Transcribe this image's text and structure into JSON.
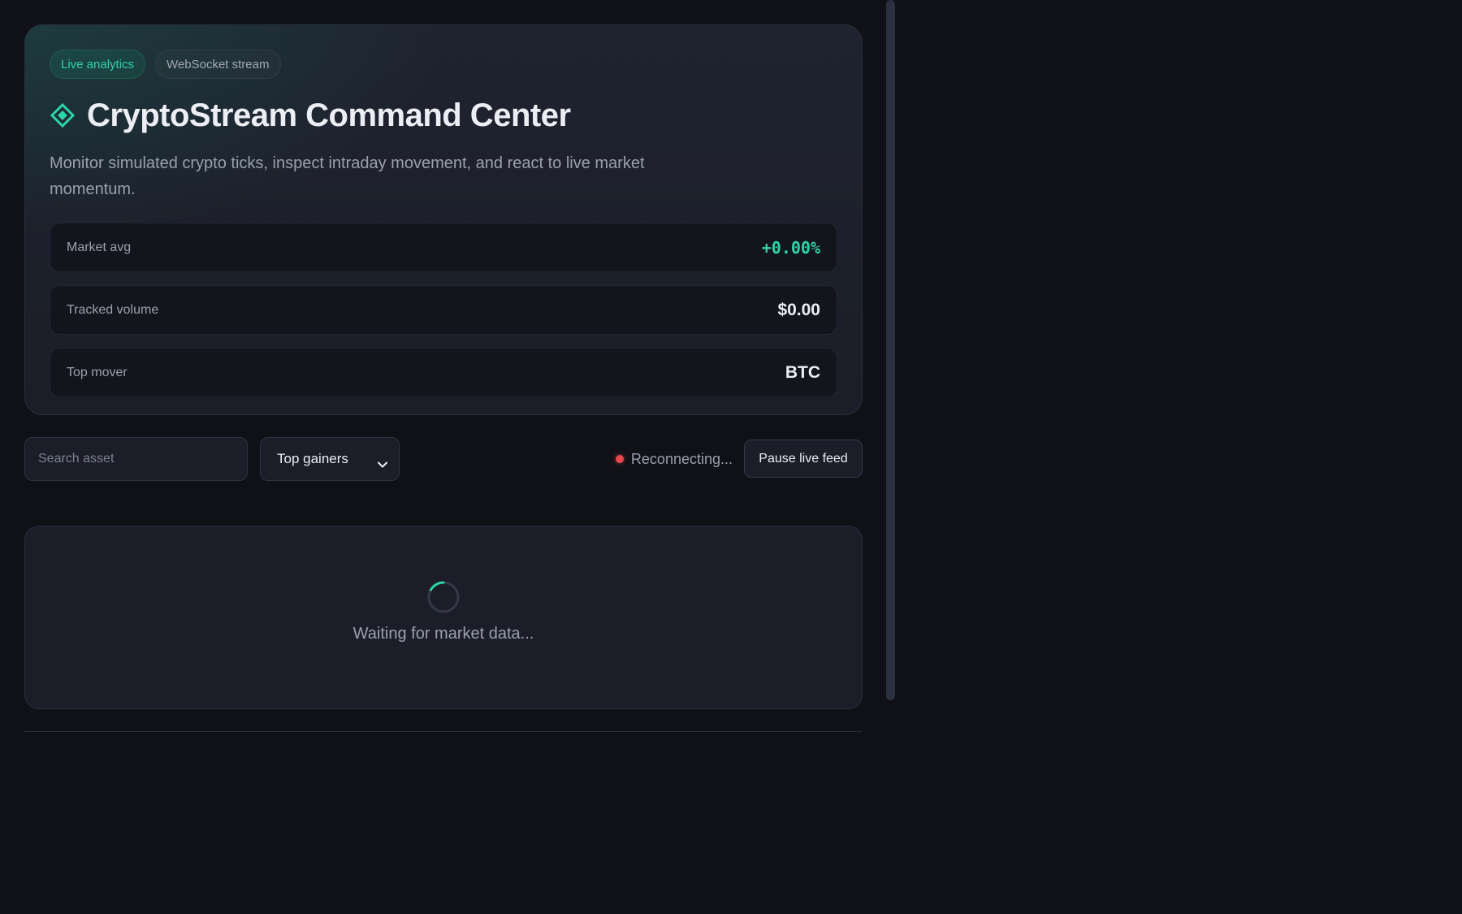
{
  "hero": {
    "pills": [
      "Live analytics",
      "WebSocket stream"
    ],
    "icon": "diamond-icon",
    "title": "CryptoStream Command Center",
    "subtitle": "Monitor simulated crypto ticks, inspect intraday movement, and react to live market momentum.",
    "stats": [
      {
        "label": "Market avg",
        "value": "+0.00%"
      },
      {
        "label": "Tracked volume",
        "value": "$0.00"
      },
      {
        "label": "Top mover",
        "value": "BTC"
      }
    ]
  },
  "controls": {
    "search_placeholder": "Search asset",
    "sort_selected": "Top gainers",
    "connection_status": "Reconnecting...",
    "pause_label": "Pause live feed"
  },
  "loading": {
    "message": "Waiting for market data..."
  },
  "colors": {
    "accent": "#2dd4a7",
    "status_error": "#e5484d",
    "background": "#0f1117",
    "card": "#1b1e28"
  }
}
